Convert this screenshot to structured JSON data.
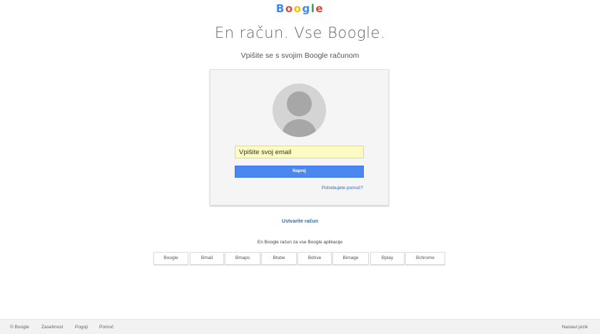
{
  "header": {
    "logo_letters": [
      "B",
      "o",
      "o",
      "g",
      "l",
      "e"
    ],
    "logo_colors": [
      "#4285f4",
      "#ea4335",
      "#fbbc05",
      "#4285f4",
      "#34a853",
      "#ea4335"
    ]
  },
  "main": {
    "headline": "En račun. Vse Boogle.",
    "subheading": "Vpišite se s svojim Boogle računom"
  },
  "login": {
    "email_placeholder": "Vpišite svoj email",
    "next_label": "Naprej",
    "help_link": "Potrebujete pomoč?"
  },
  "create_account": "Ustvarite račun",
  "tagline": "En Boogle račun za vse Boogle aplikacije",
  "apps": [
    "Boogle",
    "Bmail",
    "Bmaps",
    "Btube",
    "Bdrive",
    "Bimage",
    "Bplay",
    "Bchrome"
  ],
  "footer": {
    "links": [
      "© Boogle",
      "Zasebnost",
      "Pogoji",
      "Pomoč"
    ],
    "language": "Nastavi jezik"
  },
  "colors": {
    "accent": "#4a87ee",
    "link": "#2b6bbf",
    "input_bg": "#fbfbc3"
  }
}
